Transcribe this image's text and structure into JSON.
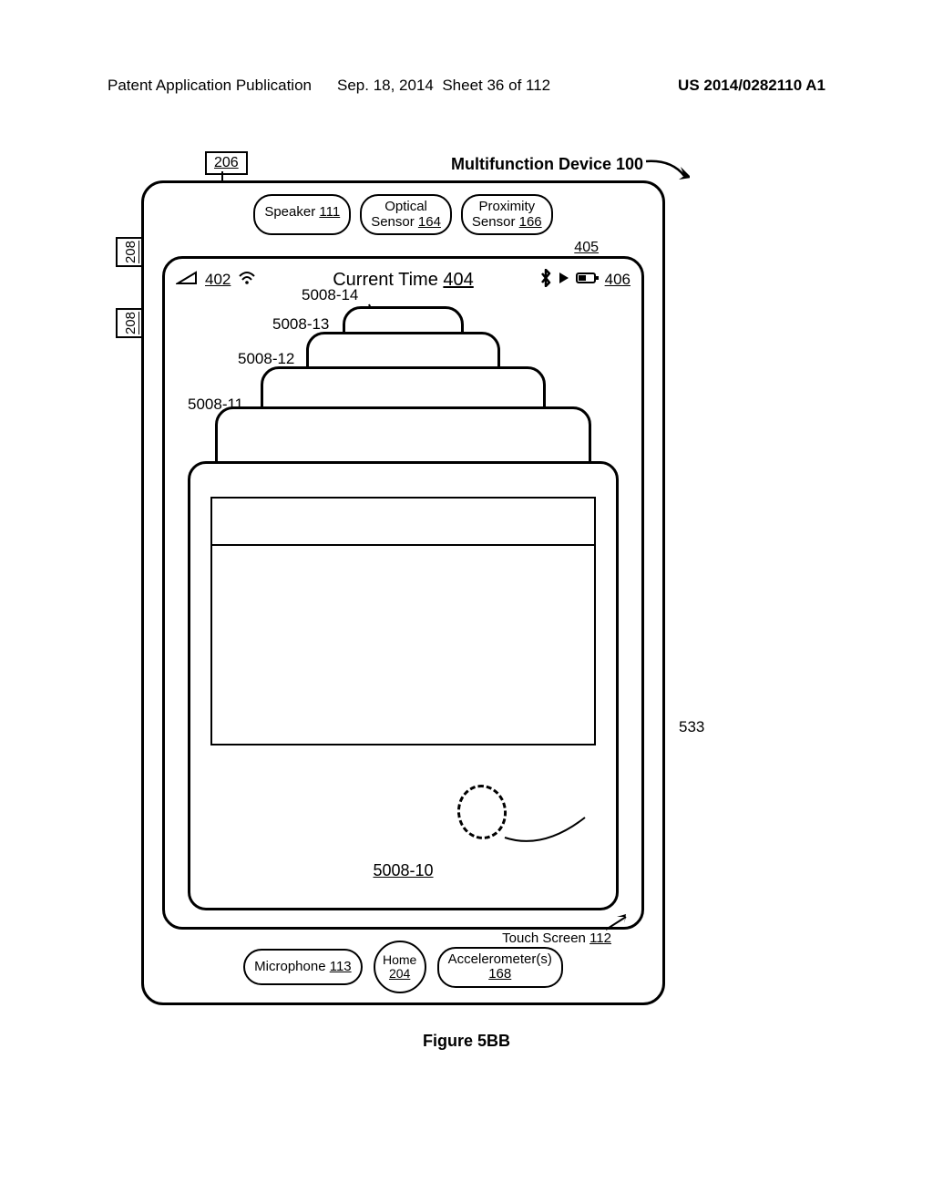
{
  "header": {
    "left": "Patent Application Publication",
    "center_date": "Sep. 18, 2014",
    "center_sheet": "Sheet 36 of 112",
    "right": "US 2014/0282110 A1"
  },
  "device_title": "Multifunction Device",
  "device_title_ref": "100",
  "refs": {
    "r206": "206",
    "r208a": "208",
    "r208b": "208",
    "r405": "405",
    "r533": "533"
  },
  "sensors": {
    "speaker_label": "Speaker",
    "speaker_ref": "111",
    "optical_label_a": "Optical",
    "optical_label_b": "Sensor",
    "optical_ref": "164",
    "prox_label_a": "Proximity",
    "prox_label_b": "Sensor",
    "prox_ref": "166"
  },
  "status": {
    "signal_ref": "402",
    "time_label": "Current Time",
    "time_ref": "404",
    "battery_ref": "406"
  },
  "cards": {
    "c14": "5008-14",
    "c13": "5008-13",
    "c12": "5008-12",
    "c11": "5008-11",
    "c10": "5008-10"
  },
  "touchscreen": {
    "label": "Touch Screen",
    "ref": "112"
  },
  "bottom": {
    "mic_label": "Microphone",
    "mic_ref": "113",
    "home_label": "Home",
    "home_ref": "204",
    "accel_label": "Accelerometer(s)",
    "accel_ref": "168"
  },
  "caption": "Figure 5BB"
}
